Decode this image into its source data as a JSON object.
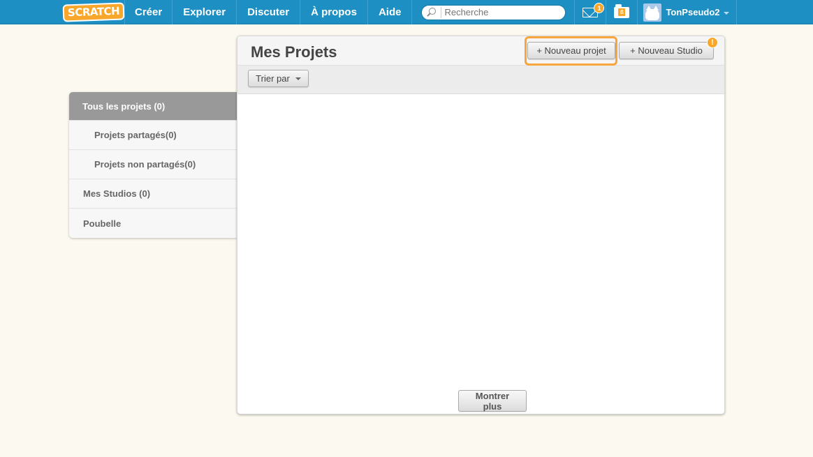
{
  "nav": {
    "logo": "SCRATCH",
    "links": [
      "Créer",
      "Explorer",
      "Discuter",
      "À propos",
      "Aide"
    ],
    "search_placeholder": "Recherche",
    "messages_count": "1",
    "mystuff_mark": "ß",
    "username": "TonPseudo2"
  },
  "sidebar": {
    "items": [
      {
        "label": "Tous les projets (0)"
      },
      {
        "label": "Projets partagés(0)"
      },
      {
        "label": "Projets non partagés(0)"
      },
      {
        "label": "Mes Studios (0)"
      },
      {
        "label": "Poubelle"
      }
    ]
  },
  "main": {
    "title": "Mes Projets",
    "new_project_label": "+ Nouveau projet",
    "new_studio_label": "+ Nouveau Studio",
    "alert_mark": "!",
    "sort_label": "Trier par",
    "show_more_label": "Montrer plus"
  },
  "colors": {
    "nav_bg": "#1d8fc3",
    "accent_orange": "#f9a72a",
    "page_bg": "#fcfaf0"
  }
}
